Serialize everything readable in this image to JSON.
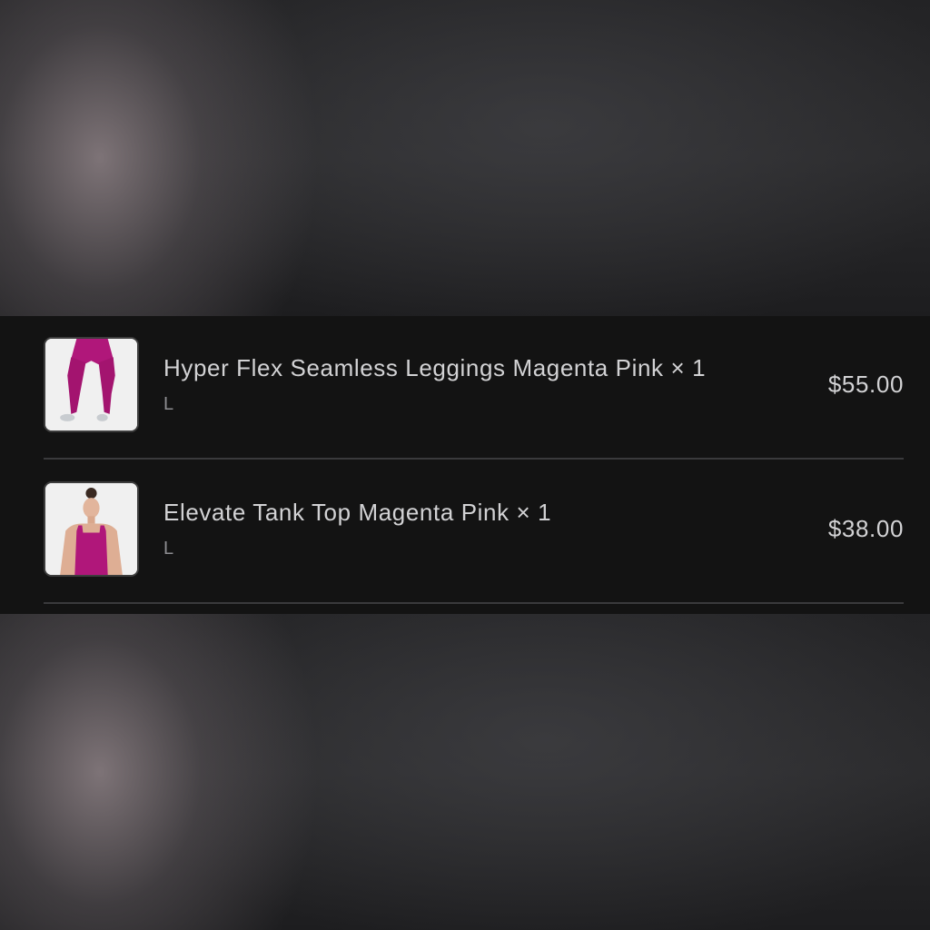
{
  "cart": {
    "items": [
      {
        "title": "Hyper Flex Seamless Leggings Magenta Pink × 1",
        "size": "L",
        "price": "$55.00",
        "image_icon": "leggings-product-photo",
        "product_color": "#b0177a"
      },
      {
        "title": "Elevate Tank Top Magenta Pink × 1",
        "size": "L",
        "price": "$38.00",
        "image_icon": "tank-top-product-photo",
        "product_color": "#b0177a"
      }
    ]
  }
}
